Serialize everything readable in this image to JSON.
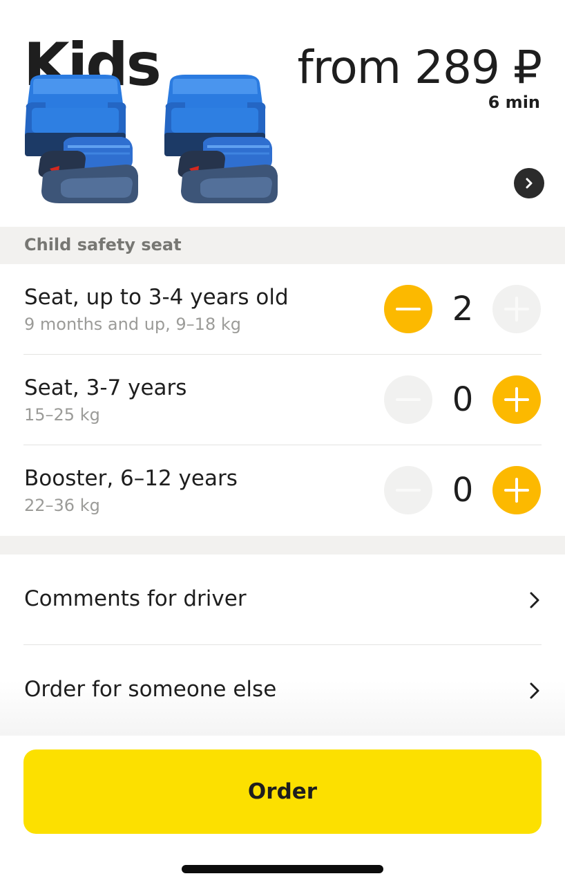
{
  "tariff": {
    "title": "Kids",
    "price": "from 289 ₽",
    "eta": "6 min"
  },
  "section": {
    "title": "Child safety seat"
  },
  "seats": [
    {
      "title": "Seat, up to 3-4 years old",
      "subtitle": "9 months and up, 9–18 kg",
      "count": "2",
      "minus_active": true,
      "plus_active": false
    },
    {
      "title": "Seat, 3-7 years",
      "subtitle": "15–25 kg",
      "count": "0",
      "minus_active": false,
      "plus_active": true
    },
    {
      "title": "Booster, 6–12 years",
      "subtitle": "22–36 kg",
      "count": "0",
      "minus_active": false,
      "plus_active": true
    }
  ],
  "options": [
    {
      "label": "Comments for driver"
    },
    {
      "label": "Order for someone else"
    }
  ],
  "order_button": {
    "label": "Order"
  },
  "colors": {
    "accent": "#fcb900",
    "order_button": "#fce000",
    "inactive_button": "#f1f1f0",
    "section_bg": "#f2f1ef"
  },
  "icons": {
    "seat_illustration": "child-car-seat-icon",
    "info": "chevron-right-circle-icon",
    "minus": "minus-icon",
    "plus": "plus-icon",
    "option_chevron": "chevron-right-icon"
  }
}
